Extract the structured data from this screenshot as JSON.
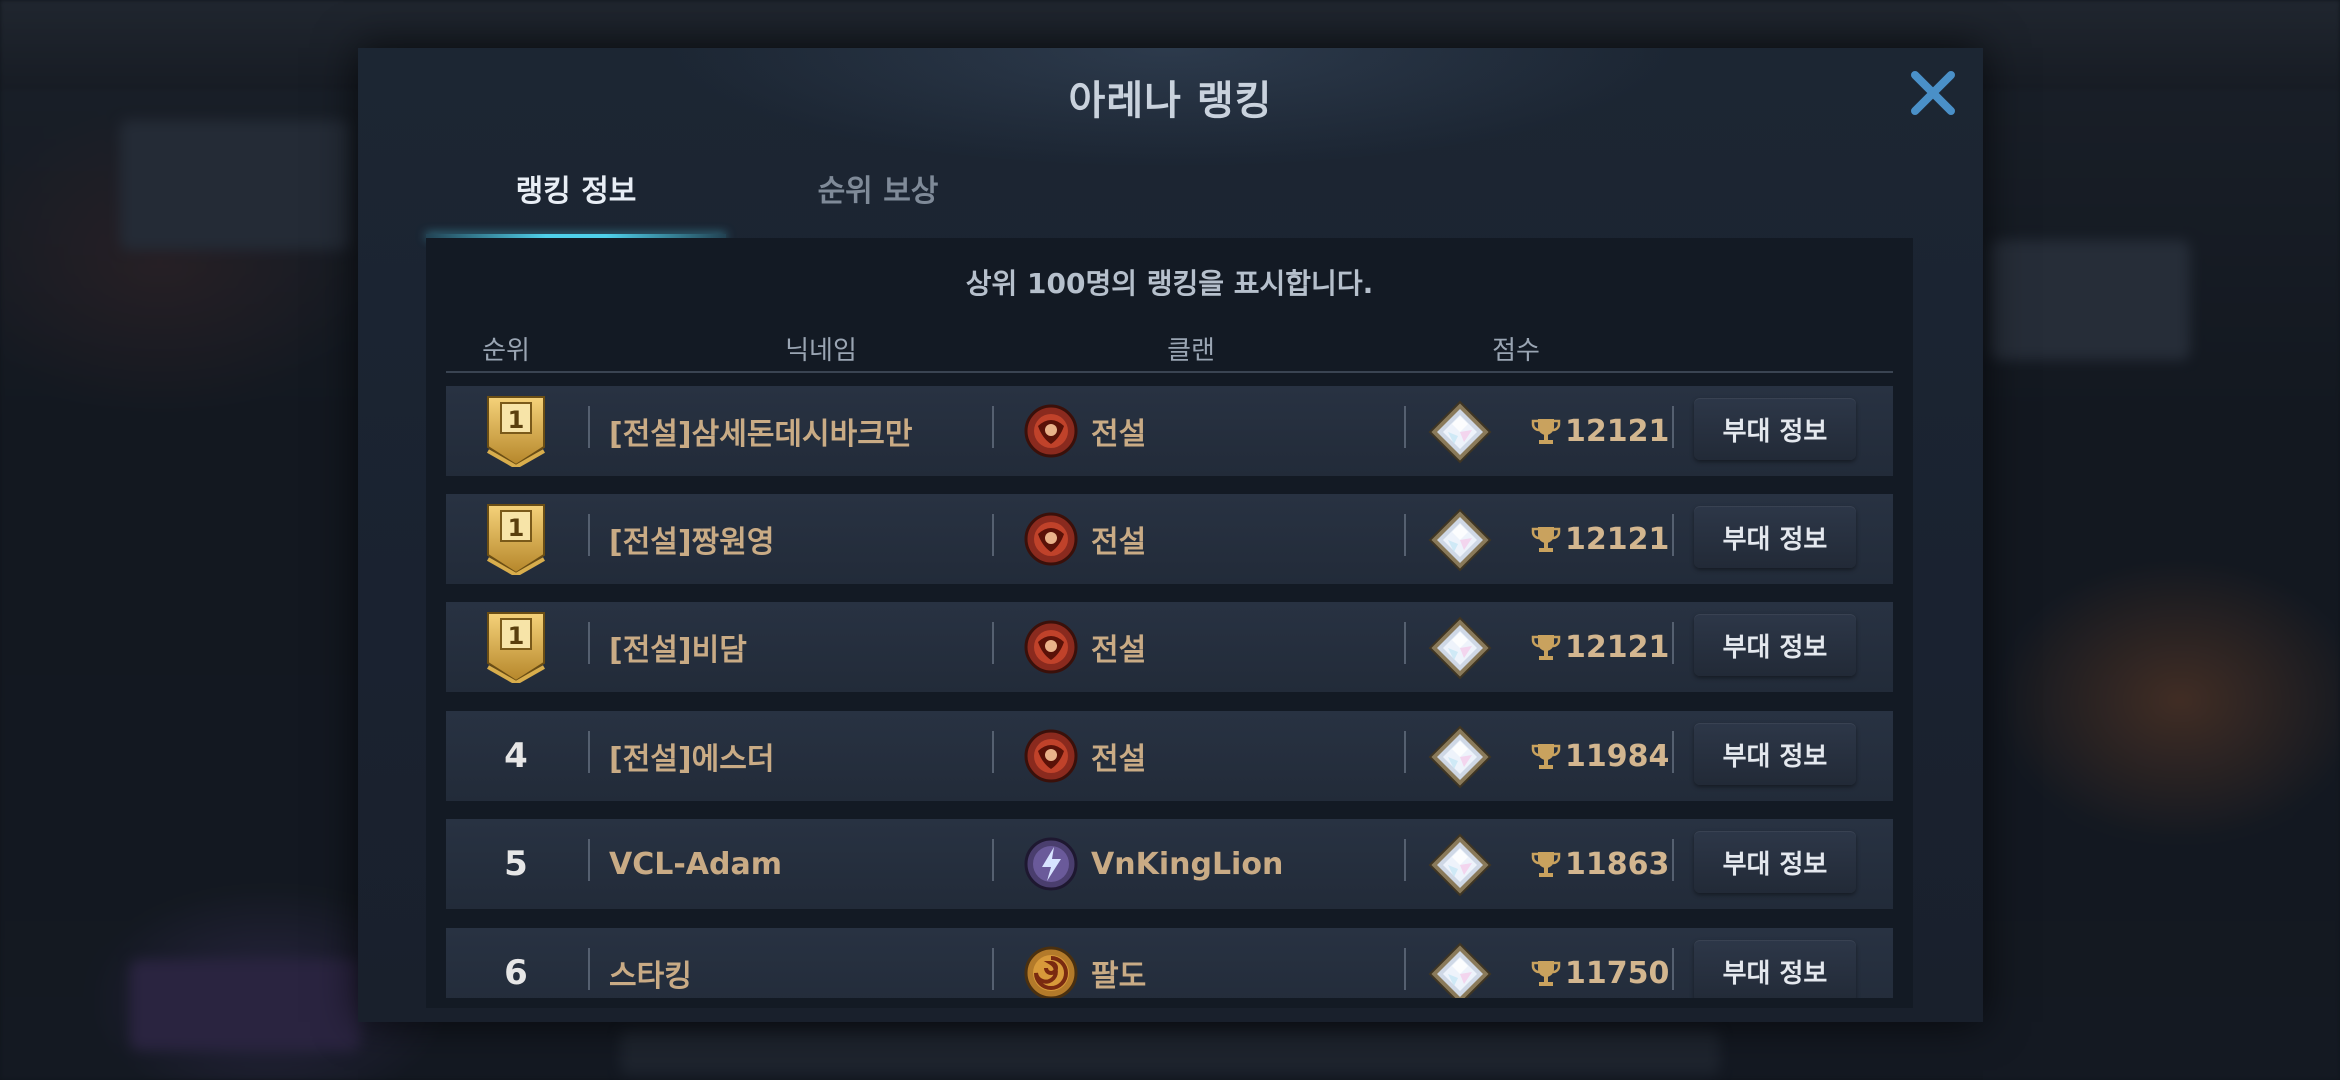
{
  "modal": {
    "title": "아레나 랭킹",
    "close_icon": "close-icon"
  },
  "tabs": [
    {
      "label": "랭킹 정보",
      "active": true
    },
    {
      "label": "순위 보상",
      "active": false
    }
  ],
  "notice": "상위 100명의 랭킹을 표시합니다.",
  "columns": {
    "rank": "순위",
    "nickname": "닉네임",
    "clan": "클랜",
    "score": "점수"
  },
  "colors": {
    "accent_tab": "#4fd0ea",
    "name_text": "#c9ab85",
    "gold_badge": "#e0b64a"
  },
  "rows": [
    {
      "rank": "1",
      "rank_badge": true,
      "nickname": "[전설]삼세돈데시바크만",
      "clan_icon": "red-clan-emblem-icon",
      "clan": "전설",
      "gem_icon": "diamond-gem-icon",
      "trophy_icon": "trophy-icon",
      "score": "12121",
      "button": "부대 정보"
    },
    {
      "rank": "1",
      "rank_badge": true,
      "nickname": "[전설]짱원영",
      "clan_icon": "red-clan-emblem-icon",
      "clan": "전설",
      "gem_icon": "diamond-gem-icon",
      "trophy_icon": "trophy-icon",
      "score": "12121",
      "button": "부대 정보"
    },
    {
      "rank": "1",
      "rank_badge": true,
      "nickname": "[전설]비담",
      "clan_icon": "red-clan-emblem-icon",
      "clan": "전설",
      "gem_icon": "diamond-gem-icon",
      "trophy_icon": "trophy-icon",
      "score": "12121",
      "button": "부대 정보"
    },
    {
      "rank": "4",
      "rank_badge": false,
      "nickname": "[전설]에스더",
      "clan_icon": "red-clan-emblem-icon",
      "clan": "전설",
      "gem_icon": "diamond-gem-icon",
      "trophy_icon": "trophy-icon",
      "score": "11984",
      "button": "부대 정보"
    },
    {
      "rank": "5",
      "rank_badge": false,
      "nickname": "VCL-Adam",
      "clan_icon": "purple-lightning-emblem-icon",
      "clan": "VnKingLion",
      "gem_icon": "diamond-gem-icon",
      "trophy_icon": "trophy-icon",
      "score": "11863",
      "button": "부대 정보"
    },
    {
      "rank": "6",
      "rank_badge": false,
      "nickname": "스타킹",
      "clan_icon": "gold-swirl-emblem-icon",
      "clan": "팔도",
      "gem_icon": "diamond-gem-icon",
      "trophy_icon": "trophy-icon",
      "score": "11750",
      "button": "부대 정보"
    }
  ]
}
